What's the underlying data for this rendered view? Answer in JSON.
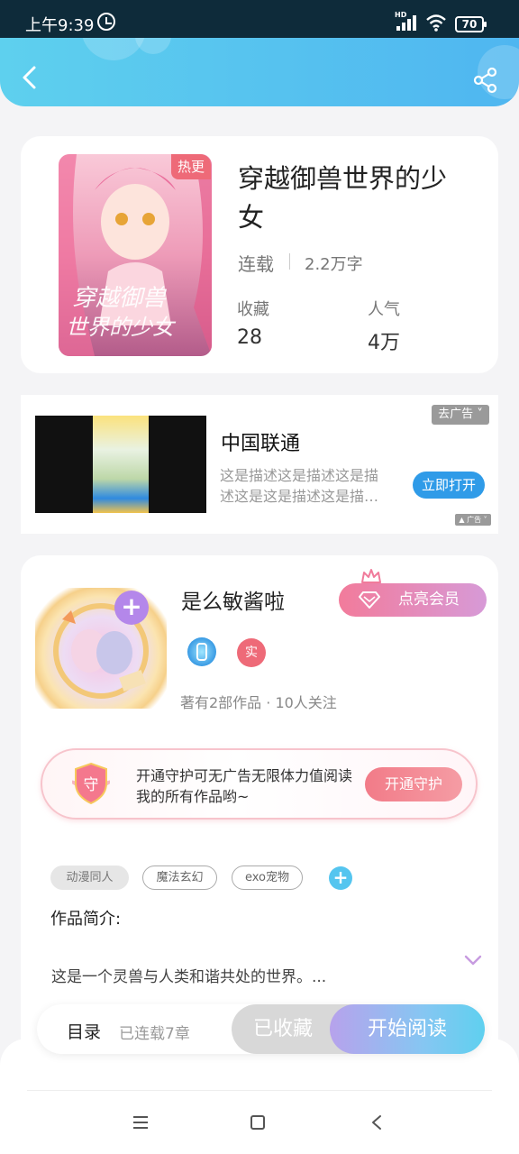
{
  "status_bar": {
    "time": "上午9:39",
    "hd": "HD",
    "battery": "70"
  },
  "book": {
    "hot_tag": "热更",
    "title": "穿越御兽世界的少女",
    "status": "连载",
    "words": "2.2万字",
    "collect_label": "收藏",
    "collect_value": "28",
    "popularity_label": "人气",
    "popularity_value": "4万"
  },
  "ad": {
    "close_label": "去广告",
    "name": "中国联通",
    "description": "这是描述这是描述这是描述这是这是描述这是描…",
    "open_button": "立即打开",
    "mark": "广告"
  },
  "author": {
    "name": "是么敏酱啦",
    "vip_button": "点亮会员",
    "badge_real": "实",
    "stats": "著有2部作品 · 10人关注"
  },
  "guard": {
    "icon_text": "守",
    "text": "开通守护可无广告无限体力值阅读我的所有作品哟~",
    "button": "开通守护"
  },
  "tags": [
    "动漫同人",
    "魔法玄幻",
    "exo宠物"
  ],
  "intro": {
    "title": "作品简介:",
    "text": "这是一个灵兽与人类和谐共处的世界。..."
  },
  "bottom_bar": {
    "toc": "目录",
    "toc_sub": "已连载7章",
    "collected": "已收藏",
    "read": "开始阅读"
  },
  "colors": {
    "accent": "#4fb6f0",
    "hot": "#ee6a78",
    "vip": "#d79ad7",
    "ad_button": "#2f9be8"
  }
}
